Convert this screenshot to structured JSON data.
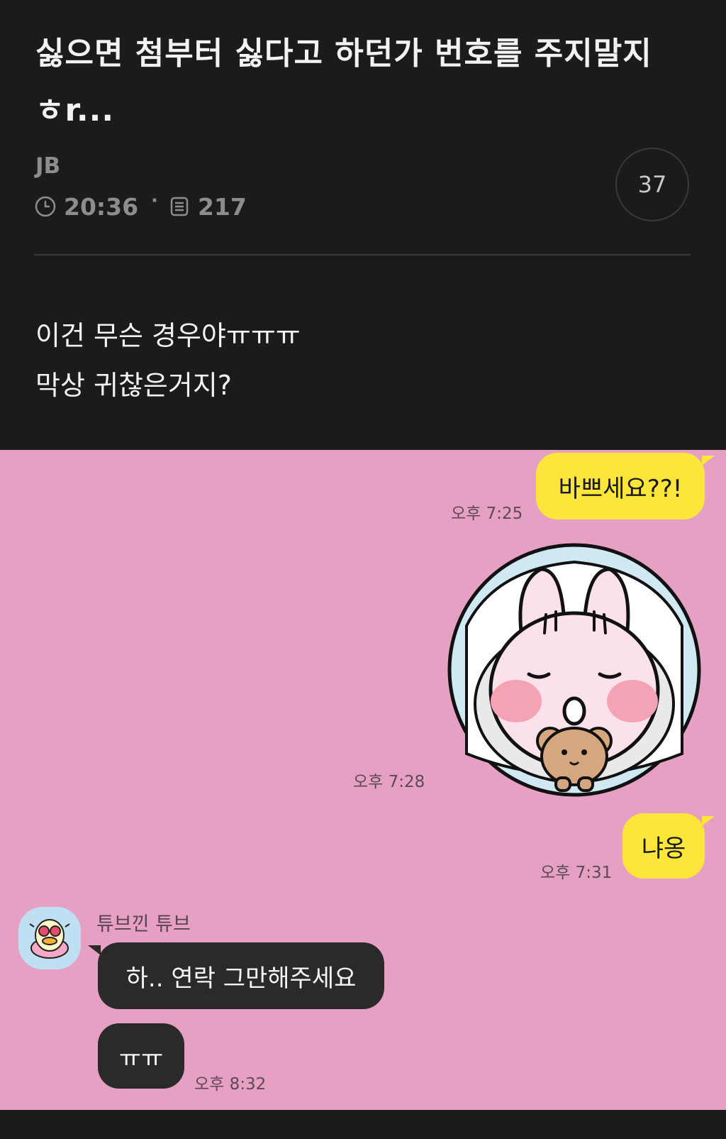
{
  "post": {
    "title_line1": "싫으면 첨부터 싫다고 하던가 번호를 주지말지",
    "title_line2": "ㅎr...",
    "author": "JB",
    "time": "20:36",
    "separator": "·",
    "views": "217",
    "comment_count": "37",
    "body_line1": "이건 무슨 경우야ㅠㅠㅠ",
    "body_line2": "막상 귀찮은거지?"
  },
  "chat": {
    "messages": [
      {
        "text": "바쁘세요??!",
        "time": "오후 7:25"
      },
      {
        "sticker": "sleeping-bunny-with-bear-sticker",
        "time": "오후 7:28"
      },
      {
        "text": "냐옹",
        "time": "오후 7:31"
      }
    ],
    "reply_sender": "튜브낀 튜브",
    "replies": [
      {
        "text": "하.. 연락 그만해주세요"
      },
      {
        "text": "ㅠㅠ",
        "time": "오후 8:32"
      }
    ]
  },
  "colors": {
    "background": "#1b1b1c",
    "chat_background": "#e5a0c3",
    "my_bubble": "#fce63c",
    "their_bubble": "#2a2a2a"
  }
}
